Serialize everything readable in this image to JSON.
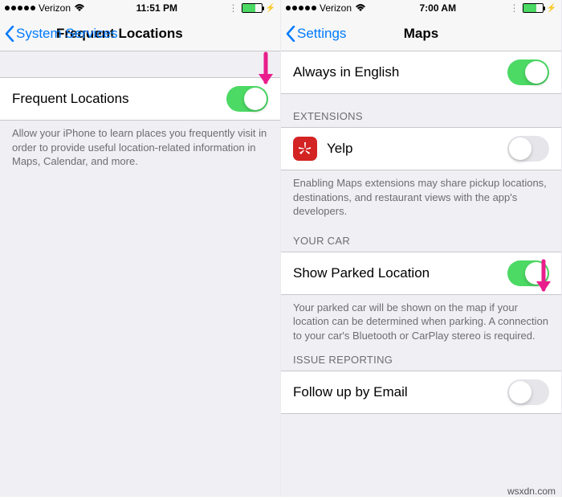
{
  "left_phone": {
    "status": {
      "carrier": "Verizon",
      "time": "11:51 PM"
    },
    "nav": {
      "back": "System Services",
      "title": "Frequent Locations"
    },
    "row1": {
      "label": "Frequent Locations"
    },
    "footer1": "Allow your iPhone to learn places you frequently visit in order to provide useful location-related information in Maps, Calendar, and more."
  },
  "right_phone": {
    "status": {
      "carrier": "Verizon",
      "time": "7:00 AM"
    },
    "nav": {
      "back": "Settings",
      "title": "Maps"
    },
    "row_english": {
      "label": "Always in English"
    },
    "section_ext": "EXTENSIONS",
    "row_yelp": {
      "label": "Yelp"
    },
    "footer_ext": "Enabling Maps extensions may share pickup locations, destinations, and restaurant views with the app's developers.",
    "section_car": "YOUR CAR",
    "row_parked": {
      "label": "Show Parked Location"
    },
    "footer_car": "Your parked car will be shown on the map if your location can be determined when parking. A connection to your car's Bluetooth or CarPlay stereo is required.",
    "section_issue": "ISSUE REPORTING",
    "row_followup": {
      "label": "Follow up by Email"
    }
  },
  "watermark": "wsxdn.com"
}
